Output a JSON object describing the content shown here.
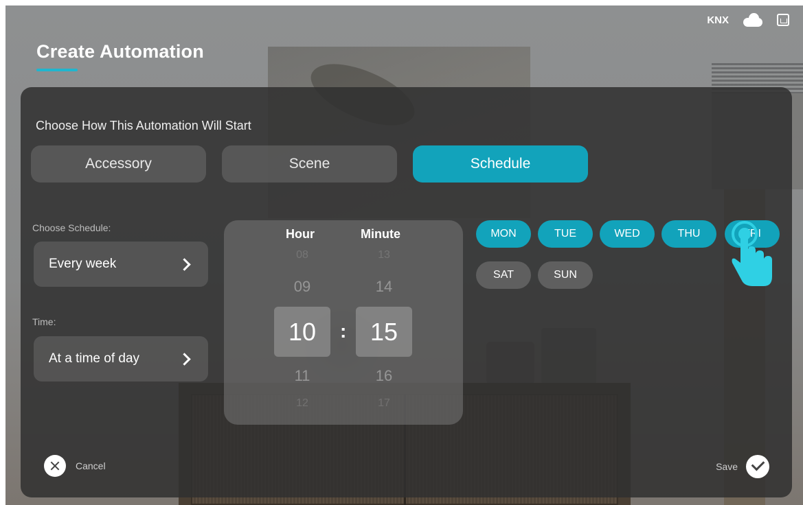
{
  "status": {
    "protocol_label": "KNX",
    "cloud_icon": "cloud-icon",
    "gateway_icon": "home-icon"
  },
  "header": {
    "title": "Create Automation",
    "accent": "#1fb6cf"
  },
  "panel": {
    "prompt": "Choose How This Automation Will Start",
    "tabs": [
      {
        "label": "Accessory",
        "active": false
      },
      {
        "label": "Scene",
        "active": false
      },
      {
        "label": "Schedule",
        "active": true
      }
    ],
    "schedule": {
      "label": "Choose Schedule:",
      "value": "Every week"
    },
    "time": {
      "label": "Time:",
      "value": "At a time of day"
    }
  },
  "picker": {
    "hour_label": "Hour",
    "minute_label": "Minute",
    "hours": {
      "faint_above": "08",
      "above": "09",
      "selected": "10",
      "below": "11",
      "faint_below": "12"
    },
    "minutes": {
      "faint_above": "13",
      "above": "14",
      "selected": "15",
      "below": "16",
      "faint_below": "17"
    },
    "separator": ":"
  },
  "days": [
    {
      "label": "MON",
      "selected": true
    },
    {
      "label": "TUE",
      "selected": true
    },
    {
      "label": "WED",
      "selected": true
    },
    {
      "label": "THU",
      "selected": true
    },
    {
      "label": "FRI",
      "selected": true
    },
    {
      "label": "SAT",
      "selected": false
    },
    {
      "label": "SUN",
      "selected": false
    }
  ],
  "footer": {
    "cancel_label": "Cancel",
    "save_label": "Save"
  },
  "colors": {
    "active": "#12a3bb",
    "panel": "#303030"
  }
}
